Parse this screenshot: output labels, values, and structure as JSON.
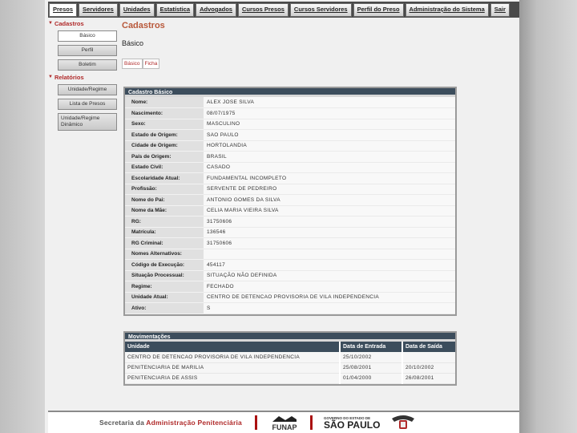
{
  "nav": {
    "tabs": [
      {
        "label": "Presos",
        "active": true
      },
      {
        "label": "Servidores",
        "active": false
      },
      {
        "label": "Unidades",
        "active": false
      },
      {
        "label": "Estatística",
        "active": false
      },
      {
        "label": "Advogados",
        "active": false
      },
      {
        "label": "Cursos Presos",
        "active": false
      },
      {
        "label": "Cursos Servidores",
        "active": false
      },
      {
        "label": "Perfil do Preso",
        "active": false
      },
      {
        "label": "Administração do Sistema",
        "active": false
      },
      {
        "label": "Sair",
        "active": false
      }
    ]
  },
  "sidebar": {
    "cadastros_label": "Cadastros",
    "cadastros_items": [
      "Básico",
      "Perfil",
      "Boletim"
    ],
    "relatorios_label": "Relatórios",
    "relatorios_items": [
      "Unidade/Regime",
      "Lista de Presos",
      "Unidade/Regime Dinâmico"
    ]
  },
  "content": {
    "title": "Cadastros",
    "subtitle": "Básico",
    "subtabs": [
      "Básico",
      "Ficha"
    ]
  },
  "cadastro": {
    "title": "Cadastro Básico",
    "rows": [
      {
        "k": "Nome:",
        "v": "ALEX JOSE SILVA"
      },
      {
        "k": "Nascimento:",
        "v": "08/07/1975"
      },
      {
        "k": "Sexo:",
        "v": "MASCULINO"
      },
      {
        "k": "Estado de Origem:",
        "v": "SAO PAULO"
      },
      {
        "k": "Cidade de Origem:",
        "v": "HORTOLANDIA"
      },
      {
        "k": "País de Origem:",
        "v": "BRASIL"
      },
      {
        "k": "Estado Civil:",
        "v": "CASADO"
      },
      {
        "k": "Escolaridade Atual:",
        "v": "FUNDAMENTAL INCOMPLETO"
      },
      {
        "k": "Profissão:",
        "v": "SERVENTE DE PEDREIRO"
      },
      {
        "k": "Nome do Pai:",
        "v": "ANTONIO GOMES DA SILVA"
      },
      {
        "k": "Nome da Mãe:",
        "v": "CELIA MARIA VIEIRA SILVA"
      },
      {
        "k": "RG:",
        "v": "31750606"
      },
      {
        "k": "Matrícula:",
        "v": "136546"
      },
      {
        "k": "RG Criminal:",
        "v": "31750606"
      },
      {
        "k": "Nomes Alternativos:",
        "v": ""
      },
      {
        "k": "Código de Execução:",
        "v": "454117"
      },
      {
        "k": "Situação Processual:",
        "v": "SITUAÇÃO NÃO DEFINIDA"
      },
      {
        "k": "Regime:",
        "v": "FECHADO"
      },
      {
        "k": "Unidade Atual:",
        "v": "CENTRO DE DETENCAO PROVISORIA DE VILA INDEPENDENCIA"
      },
      {
        "k": "Ativo:",
        "v": "S"
      }
    ]
  },
  "movimentacoes": {
    "title": "Movimentações",
    "headers": [
      "Unidade",
      "Data de Entrada",
      "Data de Saída"
    ],
    "rows": [
      [
        "CENTRO DE DETENCAO PROVISORIA DE VILA INDEPENDENCIA",
        "25/10/2002",
        ""
      ],
      [
        "PENITENCIARIA DE MARILIA",
        "25/08/2001",
        "20/10/2002"
      ],
      [
        "PENITENCIARIA DE ASSIS",
        "01/04/2000",
        "26/08/2001"
      ]
    ]
  },
  "footer": {
    "secretaria_prefix": "Secretaria da ",
    "secretaria_accent": "Administração Penitenciária",
    "funap": "FUNAP",
    "sp_small": "GOVERNO DO ESTADO DE",
    "sp_big": "SÃO PAULO"
  },
  "colors": {
    "header_bg": "#3c4d5c",
    "accent": "#b02a2a",
    "title": "#b8583a"
  }
}
